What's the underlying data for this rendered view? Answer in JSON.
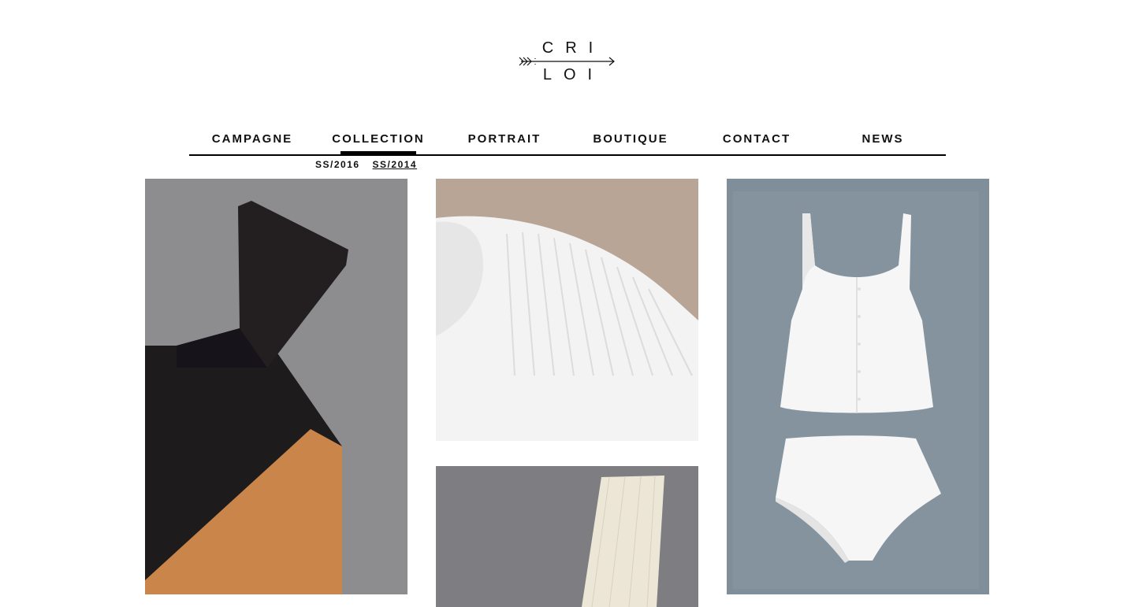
{
  "logo": {
    "top_text": "CRI",
    "bottom_text": "LOI"
  },
  "nav": {
    "items": [
      {
        "label": "CAMPAGNE",
        "active": false
      },
      {
        "label": "COLLECTION",
        "active": true
      },
      {
        "label": "PORTRAIT",
        "active": false
      },
      {
        "label": "BOUTIQUE",
        "active": false
      },
      {
        "label": "CONTACT",
        "active": false
      },
      {
        "label": "NEWS",
        "active": false
      }
    ]
  },
  "subnav": {
    "items": [
      {
        "label": "SS/2016",
        "current": false
      },
      {
        "label": "SS/2014",
        "current": true
      }
    ]
  },
  "gallery": {
    "images": [
      {
        "name": "black-orange-top-photo",
        "bg": "#8d8d8f"
      },
      {
        "name": "white-pleated-shirt-photo",
        "bg": "#b9a596"
      },
      {
        "name": "cream-knit-strip-photo",
        "bg": "#7e7e82"
      },
      {
        "name": "white-top-and-briefs-photo",
        "bg": "#7f8e99"
      }
    ]
  },
  "colors": {
    "text": "#111111",
    "background": "#ffffff",
    "rule": "#000000"
  }
}
